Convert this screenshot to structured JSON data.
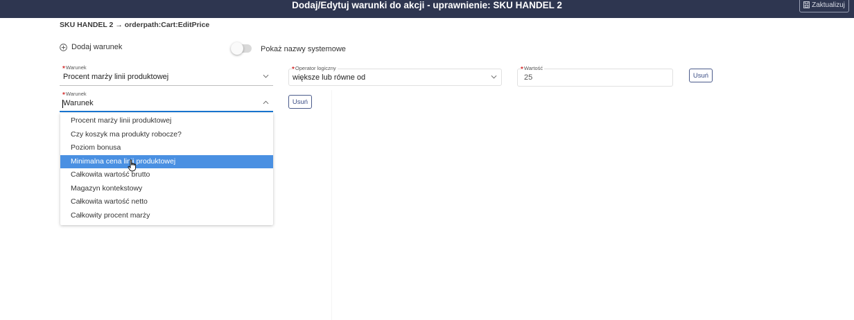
{
  "header": {
    "title": "Dodaj/Edytuj warunki do akcji - uprawnienie: SKU HANDEL 2",
    "update_label": "Zaktualizuj"
  },
  "breadcrumb": "SKU HANDEL 2 → orderpath:Cart:EditPrice",
  "toolbar": {
    "add_condition_label": "Dodaj warunek",
    "show_system_names_label": "Pokaż nazwy systemowe",
    "show_system_names_on": false
  },
  "row1": {
    "condition": {
      "label": "Warunek",
      "value": "Procent marży linii produktowej"
    },
    "operator": {
      "label": "Operator logiczny",
      "value": "większe lub równe od"
    },
    "value": {
      "label": "Wartość",
      "value": "25"
    },
    "remove_label": "Usuń"
  },
  "row2": {
    "condition": {
      "label": "Warunek",
      "value": "Warunek"
    },
    "remove_label": "Usuń",
    "dropdown_options": [
      "Procent marży linii produktowej",
      "Czy koszyk ma produkty robocze?",
      "Poziom bonusa",
      "Minimalna cena linii produktowej",
      "Całkowita wartość brutto",
      "Magazyn kontekstowy",
      "Całkowita wartość netto",
      "Całkowity procent marży"
    ],
    "highlighted_option": "Minimalna cena linii produktowej"
  },
  "colors": {
    "header_bg": "#2e3650",
    "highlight": "#4a90e2",
    "required": "#d32f2f",
    "focus_underline": "#1976d2"
  },
  "icons": [
    "save-icon",
    "add-circle-icon",
    "chevron-down-icon",
    "chevron-up-icon",
    "hand-cursor-icon"
  ]
}
